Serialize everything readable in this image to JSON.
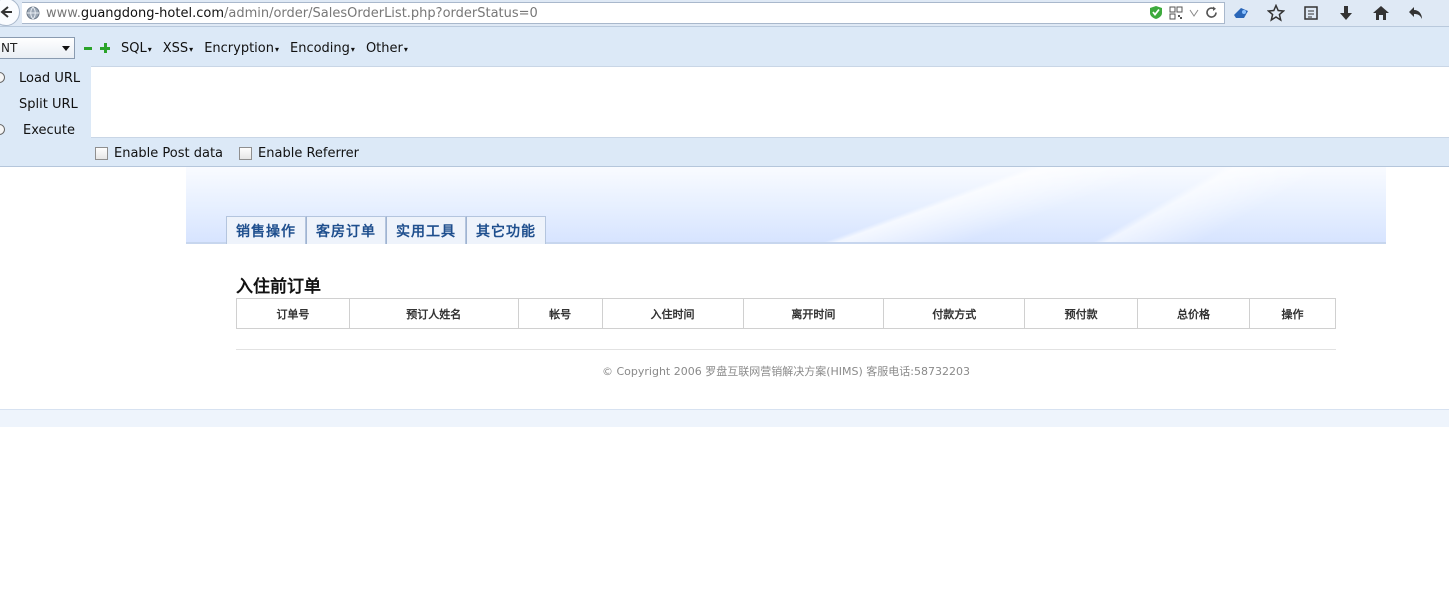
{
  "browser": {
    "url_scheme": "www.",
    "url_host": "guangdong-hotel.com",
    "url_path": "/admin/order/SalesOrderList.php?orderStatus=0"
  },
  "hackbar": {
    "select_value": "NT",
    "menus": [
      "SQL",
      "XSS",
      "Encryption",
      "Encoding",
      "Other"
    ],
    "actions": [
      "Load URL",
      "Split URL",
      "Execute"
    ],
    "checks": [
      "Enable Post data",
      "Enable Referrer"
    ]
  },
  "nav": {
    "tabs": [
      "销售操作",
      "客房订单",
      "实用工具",
      "其它功能"
    ]
  },
  "main": {
    "title": "入住前订单",
    "columns": [
      "订单号",
      "预订人姓名",
      "帐号",
      "入住时间",
      "离开时间",
      "付款方式",
      "预付款",
      "总价格",
      "操作"
    ]
  },
  "footer": {
    "copyright": "© Copyright 2006 罗盘互联网营销解决方案(HIMS) 客服电话:58732203"
  }
}
